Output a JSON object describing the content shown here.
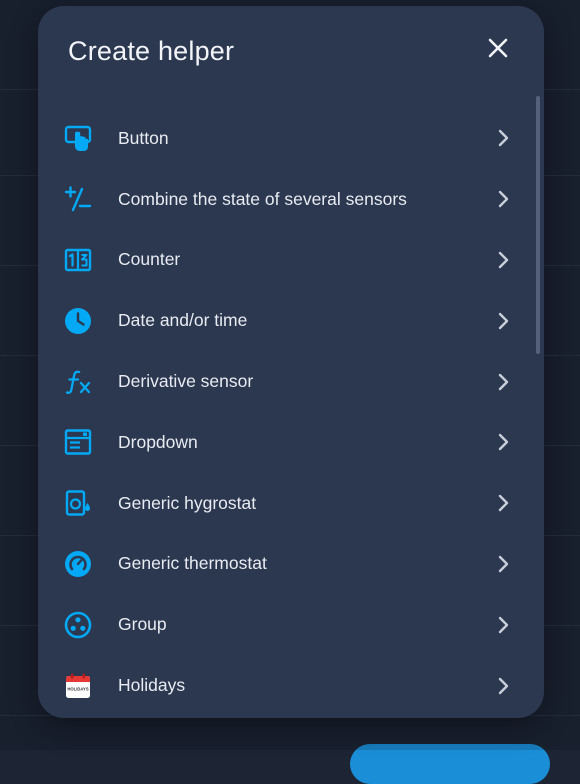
{
  "dialog": {
    "title": "Create helper",
    "close_label": "Close"
  },
  "colors": {
    "accent": "#03a9f4",
    "dialog_bg": "#2c3850",
    "text": "#e8ebf1",
    "holiday_red": "#e53935"
  },
  "helpers": [
    {
      "label": "Button",
      "icon": "button-icon"
    },
    {
      "label": "Combine the state of several sensors",
      "icon": "plus-minus-icon"
    },
    {
      "label": "Counter",
      "icon": "counter-icon"
    },
    {
      "label": "Date and/or time",
      "icon": "clock-icon"
    },
    {
      "label": "Derivative sensor",
      "icon": "function-icon"
    },
    {
      "label": "Dropdown",
      "icon": "dropdown-icon"
    },
    {
      "label": "Generic hygrostat",
      "icon": "hygrostat-icon"
    },
    {
      "label": "Generic thermostat",
      "icon": "thermostat-icon"
    },
    {
      "label": "Group",
      "icon": "group-icon"
    },
    {
      "label": "Holidays",
      "icon": "holidays-calendar-icon",
      "icon_text": "HOLIDAYS"
    }
  ]
}
